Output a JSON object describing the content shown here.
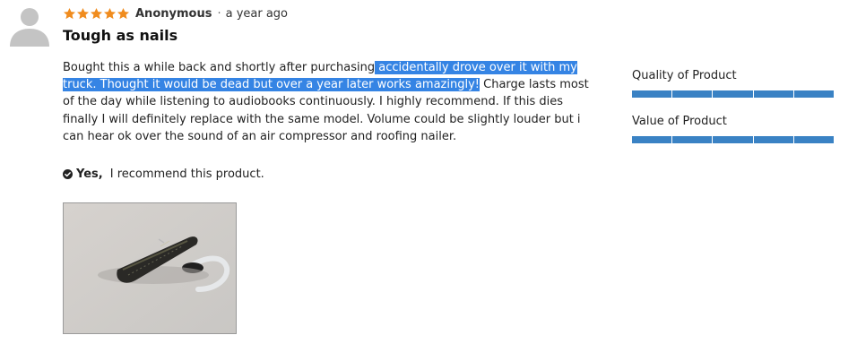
{
  "review": {
    "rating": 5,
    "rating_max": 5,
    "author": "Anonymous",
    "separator": "·",
    "time": "a year ago",
    "title": "Tough as nails",
    "body_before": "Bought this a while back and shortly after purchasing",
    "body_highlight": " accidentally drove over it with my truck. Thought it would be dead but over a year later works amazingly!",
    "body_after": " Charge lasts most of the day while listening to audiobooks continuously. I highly recommend. If this dies finally I will definitely replace with the same model. Volume could be slightly louder but i can hear ok over the sound of an air compressor and roofing nailer.",
    "recommend": {
      "answer": "Yes",
      "suffix": ",",
      "text": "I recommend this product."
    }
  },
  "ratings": [
    {
      "label": "Quality of Product",
      "value": 5,
      "max": 5
    },
    {
      "label": "Value of Product",
      "value": 5,
      "max": 5
    }
  ],
  "colors": {
    "star": "#f08c1e",
    "highlight": "#3584e4",
    "bar": "#3a82c4",
    "avatar": "#c4c4c4"
  },
  "icons": {
    "avatar": "user-avatar-icon",
    "star": "star-icon",
    "check": "check-circle-icon"
  }
}
